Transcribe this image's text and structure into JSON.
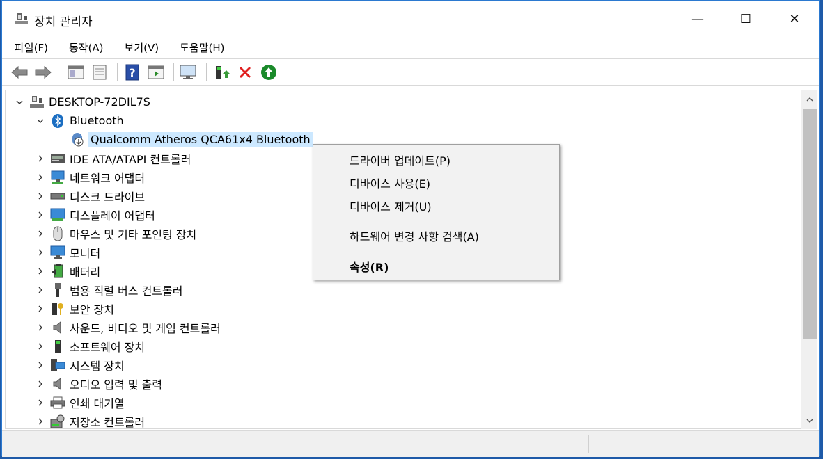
{
  "window": {
    "title": "장치 관리자",
    "min_glyph": "—",
    "max_glyph": "☐",
    "close_glyph": "✕"
  },
  "menubar": {
    "items": [
      "파일(F)",
      "동작(A)",
      "보기(V)",
      "도움말(H)"
    ]
  },
  "toolbar": {
    "buttons": [
      "back-arrow",
      "forward-arrow",
      "show-hide-console-tree",
      "properties",
      "help",
      "action-pane",
      "scan-hardware",
      "update-driver",
      "uninstall-device",
      "enable-device"
    ]
  },
  "tree": {
    "root": "DESKTOP-72DIL7S",
    "bluetooth": "Bluetooth",
    "bluetooth_child": "Qualcomm Atheros QCA61x4 Bluetooth",
    "categories": [
      "IDE ATA/ATAPI 컨트롤러",
      "네트워크 어댑터",
      "디스크 드라이브",
      "디스플레이 어댑터",
      "마우스 및 기타 포인팅 장치",
      "모니터",
      "배터리",
      "범용 직렬 버스 컨트롤러",
      "보안 장치",
      "사운드, 비디오 및 게임 컨트롤러",
      "소프트웨어 장치",
      "시스템 장치",
      "오디오 입력 및 출력",
      "인쇄 대기열",
      "저장소 컨트롤러"
    ]
  },
  "context_menu": {
    "update_driver": "드라이버 업데이트(P)",
    "enable_device": "디바이스 사용(E)",
    "uninstall_device": "디바이스 제거(U)",
    "scan_hardware": "하드웨어 변경 사항 검색(A)",
    "properties": "속성(R)"
  },
  "colors": {
    "selection": "#cce8ff",
    "window_border": "#2b79d0",
    "desktop": "#1e5aa8"
  }
}
